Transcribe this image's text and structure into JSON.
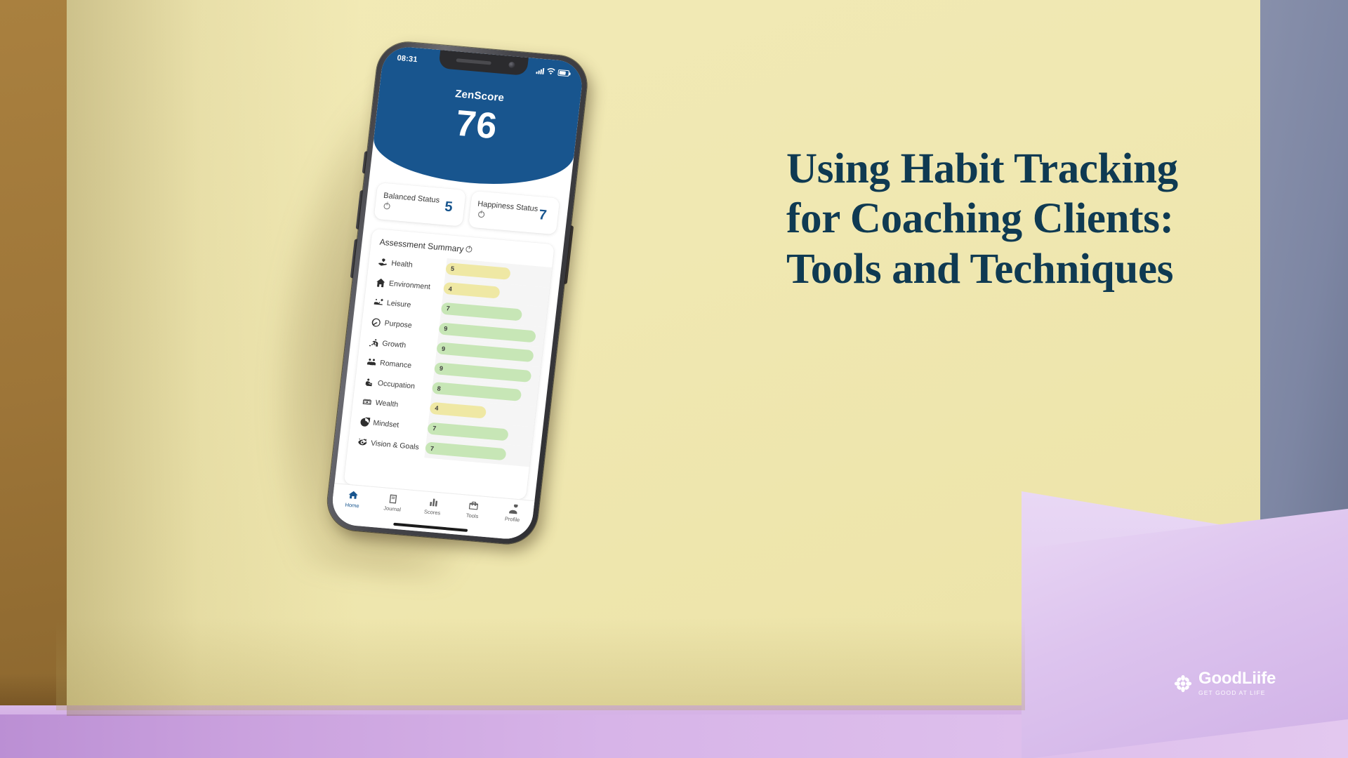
{
  "headline": "Using Habit Tracking for Coaching Clients: Tools and Techniques",
  "phone": {
    "status_bar": {
      "time": "08:31",
      "signal_icon": "signal-bars-icon",
      "wifi_icon": "wifi-icon",
      "battery_icon": "battery-icon"
    },
    "header": {
      "label": "ZenScore",
      "value": "76"
    },
    "cards": [
      {
        "label": "Balanced Status",
        "value": "5",
        "info_icon": "info-icon"
      },
      {
        "label": "Happiness Status",
        "value": "7",
        "info_icon": "info-icon"
      }
    ],
    "panel": {
      "title": "Assessment Summary",
      "info_icon": "info-icon",
      "rows": [
        {
          "label": "Health",
          "value": "5",
          "icon": "hand-heart-icon",
          "tone": "yellow"
        },
        {
          "label": "Environment",
          "value": "4",
          "icon": "house-icon",
          "tone": "yellow"
        },
        {
          "label": "Leisure",
          "value": "7",
          "icon": "relax-chair-icon",
          "tone": "green"
        },
        {
          "label": "Purpose",
          "value": "9",
          "icon": "hand-leaf-icon",
          "tone": "green"
        },
        {
          "label": "Growth",
          "value": "9",
          "icon": "stairs-person-icon",
          "tone": "green"
        },
        {
          "label": "Romance",
          "value": "9",
          "icon": "couple-heart-icon",
          "tone": "green"
        },
        {
          "label": "Occupation",
          "value": "8",
          "icon": "worker-icon",
          "tone": "green"
        },
        {
          "label": "Wealth",
          "value": "4",
          "icon": "money-icon",
          "tone": "yellow"
        },
        {
          "label": "Mindset",
          "value": "7",
          "icon": "brain-head-icon",
          "tone": "green"
        },
        {
          "label": "Vision & Goals",
          "value": "7",
          "icon": "eye-target-icon",
          "tone": "green"
        }
      ]
    },
    "nav": [
      {
        "label": "Home",
        "icon": "home-icon",
        "active": true
      },
      {
        "label": "Journal",
        "icon": "book-icon",
        "active": false
      },
      {
        "label": "Scores",
        "icon": "chart-icon",
        "active": false
      },
      {
        "label": "Tools",
        "icon": "toolbox-icon",
        "active": false
      },
      {
        "label": "Profile",
        "icon": "person-icon",
        "active": false
      }
    ]
  },
  "logo": {
    "name": "GoodLiife",
    "tagline": "GET GOOD AT LIFE",
    "mark_icon": "flower-icon"
  },
  "chart_data": {
    "type": "bar",
    "title": "Assessment Summary",
    "categories": [
      "Health",
      "Environment",
      "Leisure",
      "Purpose",
      "Growth",
      "Romance",
      "Occupation",
      "Wealth",
      "Mindset",
      "Vision & Goals"
    ],
    "values": [
      5,
      4,
      7,
      9,
      9,
      9,
      8,
      4,
      7,
      7
    ],
    "xlabel": "",
    "ylabel": "",
    "ylim": [
      0,
      10
    ],
    "grid": false,
    "legend": "none",
    "orientation": "horizontal"
  }
}
